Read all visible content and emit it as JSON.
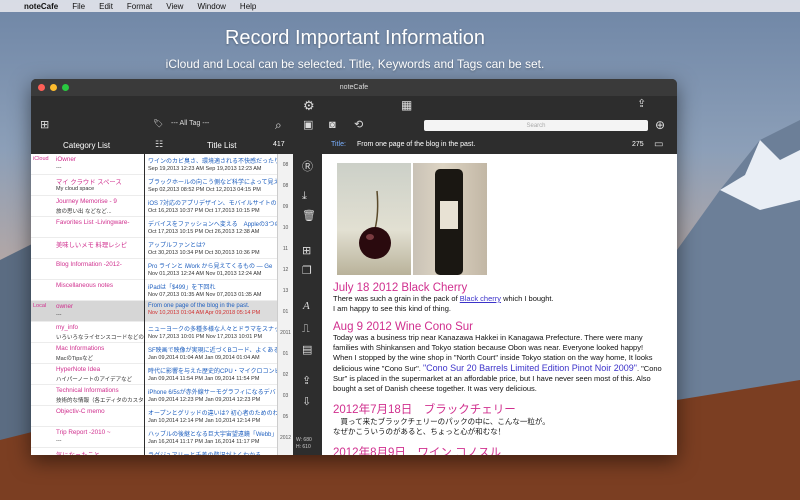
{
  "menubar": {
    "app": "noteCafe",
    "items": [
      "File",
      "Edit",
      "Format",
      "View",
      "Window",
      "Help"
    ]
  },
  "promo": {
    "headline": "Record Important Information",
    "sub": "iCloud and Local can be selected.  Title, Keywords and Tags can be set."
  },
  "window": {
    "title": "noteCafe",
    "tag_filter": "--- All Tag ---",
    "search_placeholder": "Search"
  },
  "headers": {
    "category": "Category List",
    "titles": "Title List",
    "count": "417",
    "title_label": "Title:",
    "title_value": "From one page of the blog in the past.",
    "chars": "275"
  },
  "categories": [
    {
      "src": "iCloud",
      "name": "iOwner",
      "sub": "---"
    },
    {
      "src": "",
      "name": "マイ クラウド スペース",
      "sub": "My cloud space"
    },
    {
      "src": "",
      "name": "Journey Memorise - 9",
      "sub": "旅の思い出 などなど..."
    },
    {
      "src": "",
      "name": "Favorites List -Livingware-",
      "sub": ""
    },
    {
      "src": "",
      "name": "美味しいメモ 料理レシピ",
      "sub": ""
    },
    {
      "src": "",
      "name": "Blog Information -2012-",
      "sub": ""
    },
    {
      "src": "",
      "name": "Miscellaneous notes",
      "sub": ""
    },
    {
      "src": "Local",
      "name": "owner",
      "sub": "---"
    },
    {
      "src": "",
      "name": "my_info",
      "sub": "いろいろなライセンスコードなどの情"
    },
    {
      "src": "",
      "name": "Mac Informations",
      "sub": "MacのTipsなど"
    },
    {
      "src": "",
      "name": "HyperNote Idea",
      "sub": "ハイパーノートのアイデアなど"
    },
    {
      "src": "",
      "name": "Technical Informations",
      "sub": "技術的な情報（各エディタのカスタ"
    },
    {
      "src": "",
      "name": "Objectiv-C memo",
      "sub": ""
    },
    {
      "src": "",
      "name": "Trip Report -2010 ~",
      "sub": "---"
    },
    {
      "src": "",
      "name": "気になったこと",
      "sub": ""
    }
  ],
  "titles": [
    {
      "t": "ワインのカビ臭さ、環境適される不快感だったり",
      "d": "Sep 19,2013 12:23 AM    Sep 19,2013 12:23 AM",
      "y": "08"
    },
    {
      "t": "ブラックホールの向こう側など科学によって見え",
      "d": "Sep 02,2013 08:52 PM    Oct 12,2013 04:15 PM",
      "y": "08"
    },
    {
      "t": "iOS 7対応のアプリデザイン、モバイルサイトの",
      "d": "Oct 16,2013 10:37 PM    Oct 17,2013 10:15 PM",
      "y": "09"
    },
    {
      "t": "デバイスをファッションへ変える　Appleの3つの",
      "d": "Oct 17,2013 10:15 PM    Oct 26,2013 12:38 AM",
      "y": "10"
    },
    {
      "t": "アップルファンとは?",
      "d": "Oct 30,2013 10:34 PM    Oct 30,2013 10:36 PM",
      "y": "11"
    },
    {
      "t": "Pro ラインと iWork から見えてくるもの — Ge",
      "d": "Nov 01,2013 12:24 AM    Nov 01,2013 12:24 AM",
      "y": "12"
    },
    {
      "t": "iPadは「$499」を下回れ",
      "d": "Nov 07,2013 01:35 AM    Nov 07,2013 01:35 AM",
      "y": "13"
    },
    {
      "t": "From one page of the blog in the past.",
      "d": "Nov 10,2013 01:04 AM    Apr 09,2018 05:14 PM",
      "y": "01"
    },
    {
      "t": "ニューヨークの多種多様な人々とドラマをスナップ",
      "d": "Nov 17,2013 10:01 PM    Nov 17,2013 10:01 PM",
      "y": "2011"
    },
    {
      "t": "SF映画で映像が実現に近づくBコード、よくある",
      "d": "Jan 09,2014 01:04 AM    Jan 09,2014 01:04 AM",
      "y": "01"
    },
    {
      "t": "時代に影響を与えた歴史的CPU・マイクロコンピ",
      "d": "Jan 09,2014 11:54 PM    Jan 09,2014 11:54 PM",
      "y": "02"
    },
    {
      "t": "iPhone 6/5sが赤外線サーモグラフィになるデバ",
      "d": "Jan 09,2014 12:23 PM    Jan 09,2014 12:23 PM",
      "y": "03"
    },
    {
      "t": "オープンとグリッドの違いは? 初心者のためのわか",
      "d": "Jan 10,2014 12:14 PM    Jan 10,2014 12:14 PM",
      "y": "05"
    },
    {
      "t": "ハッブルの後継となる巨大宇宙望遠鏡「Webb」",
      "d": "Jan 16,2014 11:17 PM    Jan 16,2014 11:17 PM",
      "y": "2012"
    },
    {
      "t": "ラグジュアリーと千差の贅沢がよくわかる",
      "d": "Jan 20,2014 11:24 PM    Jan 20,2014 11:24 PM",
      "y": "2013"
    }
  ],
  "editor": {
    "h1": "July 18 2012   Black Cherry",
    "p1a": " There was such a grain in the pack of ",
    "p1link": "Black cherry",
    "p1b": " which I bought.",
    "p1c": "I am happy to see this kind of thing.",
    "h2": "Aug 9 2012   Wine Cono Sur",
    "p2a": " Today was a business trip near Kanazawa Hakkei in Kanagawa Prefecture. There were many families with Shinkansen and Tokyo station because Obon was near. Everyone looked happy!",
    "p2b": " When I stopped by the wine shop in \"North Court\" inside Tokyo station on the way home, It looks delicious wine \"Cono Sur\". ",
    "p2hl": "\"Cono Sur 20 Barrels Limited Edition Pinot Noir 2009\"",
    "p2c": ". \"Cono Sur\" is placed in the supermarket at an affordable price, but I have never seen most of this. Also bought a set of Danish cheese together. It was very delicious.",
    "h3": "2012年7月18日　ブラックチェリー",
    "p3a": "　買って来たブラックチェリーのパックの中に、こんな一粒が。",
    "p3b": "なぜかこういうのがあると、ちょっと心が和むな！",
    "h4": "2012年8月9日　ワイン コノスル",
    "wh": "W: 680\nH: 610"
  },
  "colors": {
    "accent": "#d02f8e",
    "link": "#3b32c9"
  }
}
